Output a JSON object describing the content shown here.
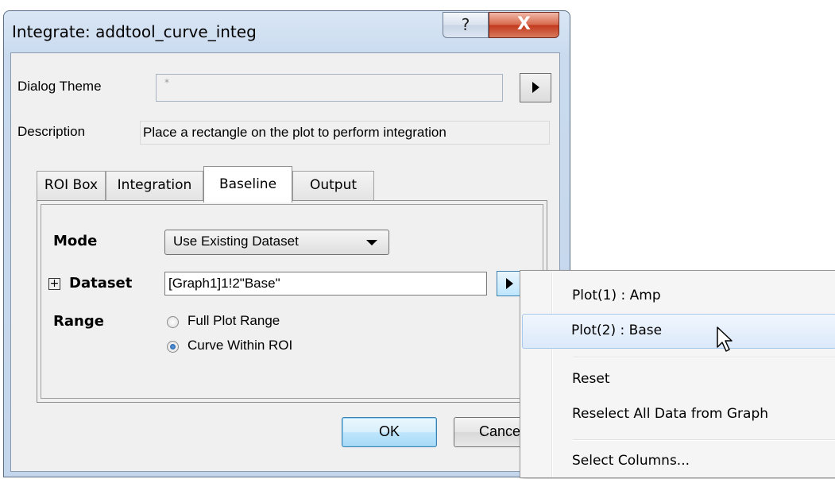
{
  "window": {
    "title": "Integrate: addtool_curve_integ",
    "help_glyph": "?",
    "close_glyph": "X"
  },
  "dialog_theme": {
    "label": "Dialog Theme",
    "value": "*"
  },
  "description": {
    "label": "Description",
    "value": "Place a rectangle on the plot to perform integration"
  },
  "tabs": [
    {
      "label": "ROI Box",
      "active": false
    },
    {
      "label": "Integration",
      "active": false
    },
    {
      "label": "Baseline",
      "active": true
    },
    {
      "label": "Output",
      "active": false
    }
  ],
  "baseline": {
    "mode_label": "Mode",
    "mode_value": "Use Existing Dataset",
    "dataset_expand": "+",
    "dataset_label": "Dataset",
    "dataset_value": "[Graph1]1!2\"Base\"",
    "range_label": "Range",
    "range_options": [
      {
        "label": "Full Plot Range",
        "selected": false
      },
      {
        "label": "Curve Within ROI",
        "selected": true
      }
    ]
  },
  "buttons": {
    "ok": "OK",
    "cancel": "Cancel"
  },
  "context_menu": {
    "items": [
      {
        "label": "Plot(1) : Amp",
        "highlighted": false
      },
      {
        "label": "Plot(2) : Base",
        "highlighted": true
      },
      {
        "label": "Reset",
        "highlighted": false
      },
      {
        "label": "Reselect All Data from Graph",
        "highlighted": false
      },
      {
        "label": "Select Columns...",
        "highlighted": false
      }
    ]
  },
  "colors": {
    "window_frame": "#c4d6ec",
    "close_button": "#c2391e",
    "default_button_border": "#3c7fb1",
    "menu_highlight": "#dbe9fa"
  }
}
